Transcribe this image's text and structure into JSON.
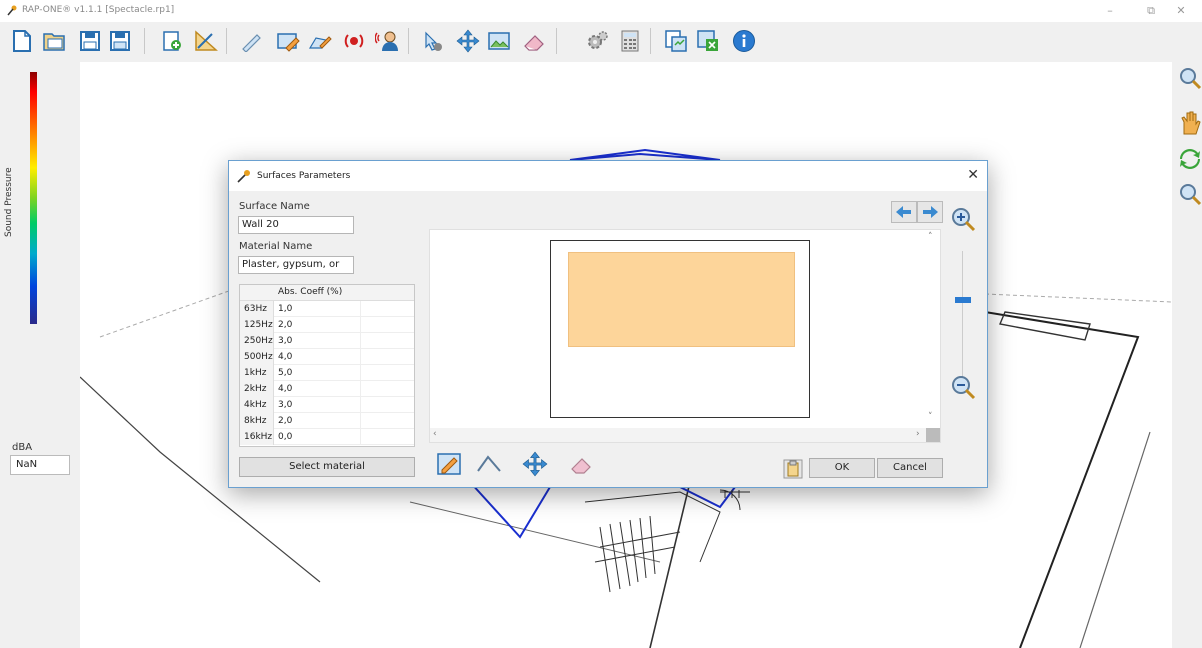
{
  "window": {
    "title": "RAP-ONE® v1.1.1 [Spectacle.rp1]",
    "controls": [
      "–",
      "⧉",
      "✕"
    ]
  },
  "left_panel": {
    "colorbar_label": "Sound Pressure",
    "unit_label": "dBA",
    "value": "NaN"
  },
  "dialog": {
    "title": "Surfaces Parameters",
    "surface_name_label": "Surface Name",
    "surface_name": "Wall 20",
    "material_name_label": "Material Name",
    "material_name": "Plaster, gypsum, or",
    "table": {
      "header": "Abs. Coeff (%)",
      "rows": [
        {
          "freq": "63Hz",
          "coeff": "1,0"
        },
        {
          "freq": "125Hz",
          "coeff": "2,0"
        },
        {
          "freq": "250Hz",
          "coeff": "3,0"
        },
        {
          "freq": "500Hz",
          "coeff": "4,0"
        },
        {
          "freq": "1kHz",
          "coeff": "5,0"
        },
        {
          "freq": "2kHz",
          "coeff": "4,0"
        },
        {
          "freq": "4kHz",
          "coeff": "3,0"
        },
        {
          "freq": "8kHz",
          "coeff": "2,0"
        },
        {
          "freq": "16kHz",
          "coeff": "0,0"
        }
      ]
    },
    "select_material_label": "Select material",
    "ok_label": "OK",
    "cancel_label": "Cancel",
    "shape_fill_color": "#fdd59a"
  }
}
